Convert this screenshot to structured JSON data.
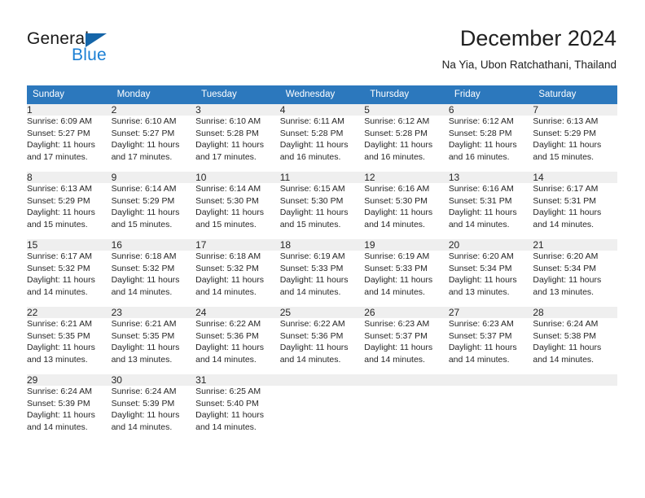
{
  "brand": {
    "word_one": "General",
    "word_two": "Blue",
    "triangle_color": "#1565a8",
    "blue_color": "#1b7fd4"
  },
  "header": {
    "title": "December 2024",
    "subtitle": "Na Yia, Ubon Ratchathani, Thailand"
  },
  "theme": {
    "header_blue": "#2c78bd",
    "row_rule_blue": "#1b6fb4",
    "daynum_band": "#efefef"
  },
  "weekdays": [
    "Sunday",
    "Monday",
    "Tuesday",
    "Wednesday",
    "Thursday",
    "Friday",
    "Saturday"
  ],
  "weeks": [
    [
      {
        "day": "1",
        "sunrise": "Sunrise: 6:09 AM",
        "sunset": "Sunset: 5:27 PM",
        "daylight_1": "Daylight: 11 hours",
        "daylight_2": "and 17 minutes."
      },
      {
        "day": "2",
        "sunrise": "Sunrise: 6:10 AM",
        "sunset": "Sunset: 5:27 PM",
        "daylight_1": "Daylight: 11 hours",
        "daylight_2": "and 17 minutes."
      },
      {
        "day": "3",
        "sunrise": "Sunrise: 6:10 AM",
        "sunset": "Sunset: 5:28 PM",
        "daylight_1": "Daylight: 11 hours",
        "daylight_2": "and 17 minutes."
      },
      {
        "day": "4",
        "sunrise": "Sunrise: 6:11 AM",
        "sunset": "Sunset: 5:28 PM",
        "daylight_1": "Daylight: 11 hours",
        "daylight_2": "and 16 minutes."
      },
      {
        "day": "5",
        "sunrise": "Sunrise: 6:12 AM",
        "sunset": "Sunset: 5:28 PM",
        "daylight_1": "Daylight: 11 hours",
        "daylight_2": "and 16 minutes."
      },
      {
        "day": "6",
        "sunrise": "Sunrise: 6:12 AM",
        "sunset": "Sunset: 5:28 PM",
        "daylight_1": "Daylight: 11 hours",
        "daylight_2": "and 16 minutes."
      },
      {
        "day": "7",
        "sunrise": "Sunrise: 6:13 AM",
        "sunset": "Sunset: 5:29 PM",
        "daylight_1": "Daylight: 11 hours",
        "daylight_2": "and 15 minutes."
      }
    ],
    [
      {
        "day": "8",
        "sunrise": "Sunrise: 6:13 AM",
        "sunset": "Sunset: 5:29 PM",
        "daylight_1": "Daylight: 11 hours",
        "daylight_2": "and 15 minutes."
      },
      {
        "day": "9",
        "sunrise": "Sunrise: 6:14 AM",
        "sunset": "Sunset: 5:29 PM",
        "daylight_1": "Daylight: 11 hours",
        "daylight_2": "and 15 minutes."
      },
      {
        "day": "10",
        "sunrise": "Sunrise: 6:14 AM",
        "sunset": "Sunset: 5:30 PM",
        "daylight_1": "Daylight: 11 hours",
        "daylight_2": "and 15 minutes."
      },
      {
        "day": "11",
        "sunrise": "Sunrise: 6:15 AM",
        "sunset": "Sunset: 5:30 PM",
        "daylight_1": "Daylight: 11 hours",
        "daylight_2": "and 15 minutes."
      },
      {
        "day": "12",
        "sunrise": "Sunrise: 6:16 AM",
        "sunset": "Sunset: 5:30 PM",
        "daylight_1": "Daylight: 11 hours",
        "daylight_2": "and 14 minutes."
      },
      {
        "day": "13",
        "sunrise": "Sunrise: 6:16 AM",
        "sunset": "Sunset: 5:31 PM",
        "daylight_1": "Daylight: 11 hours",
        "daylight_2": "and 14 minutes."
      },
      {
        "day": "14",
        "sunrise": "Sunrise: 6:17 AM",
        "sunset": "Sunset: 5:31 PM",
        "daylight_1": "Daylight: 11 hours",
        "daylight_2": "and 14 minutes."
      }
    ],
    [
      {
        "day": "15",
        "sunrise": "Sunrise: 6:17 AM",
        "sunset": "Sunset: 5:32 PM",
        "daylight_1": "Daylight: 11 hours",
        "daylight_2": "and 14 minutes."
      },
      {
        "day": "16",
        "sunrise": "Sunrise: 6:18 AM",
        "sunset": "Sunset: 5:32 PM",
        "daylight_1": "Daylight: 11 hours",
        "daylight_2": "and 14 minutes."
      },
      {
        "day": "17",
        "sunrise": "Sunrise: 6:18 AM",
        "sunset": "Sunset: 5:32 PM",
        "daylight_1": "Daylight: 11 hours",
        "daylight_2": "and 14 minutes."
      },
      {
        "day": "18",
        "sunrise": "Sunrise: 6:19 AM",
        "sunset": "Sunset: 5:33 PM",
        "daylight_1": "Daylight: 11 hours",
        "daylight_2": "and 14 minutes."
      },
      {
        "day": "19",
        "sunrise": "Sunrise: 6:19 AM",
        "sunset": "Sunset: 5:33 PM",
        "daylight_1": "Daylight: 11 hours",
        "daylight_2": "and 14 minutes."
      },
      {
        "day": "20",
        "sunrise": "Sunrise: 6:20 AM",
        "sunset": "Sunset: 5:34 PM",
        "daylight_1": "Daylight: 11 hours",
        "daylight_2": "and 13 minutes."
      },
      {
        "day": "21",
        "sunrise": "Sunrise: 6:20 AM",
        "sunset": "Sunset: 5:34 PM",
        "daylight_1": "Daylight: 11 hours",
        "daylight_2": "and 13 minutes."
      }
    ],
    [
      {
        "day": "22",
        "sunrise": "Sunrise: 6:21 AM",
        "sunset": "Sunset: 5:35 PM",
        "daylight_1": "Daylight: 11 hours",
        "daylight_2": "and 13 minutes."
      },
      {
        "day": "23",
        "sunrise": "Sunrise: 6:21 AM",
        "sunset": "Sunset: 5:35 PM",
        "daylight_1": "Daylight: 11 hours",
        "daylight_2": "and 13 minutes."
      },
      {
        "day": "24",
        "sunrise": "Sunrise: 6:22 AM",
        "sunset": "Sunset: 5:36 PM",
        "daylight_1": "Daylight: 11 hours",
        "daylight_2": "and 14 minutes."
      },
      {
        "day": "25",
        "sunrise": "Sunrise: 6:22 AM",
        "sunset": "Sunset: 5:36 PM",
        "daylight_1": "Daylight: 11 hours",
        "daylight_2": "and 14 minutes."
      },
      {
        "day": "26",
        "sunrise": "Sunrise: 6:23 AM",
        "sunset": "Sunset: 5:37 PM",
        "daylight_1": "Daylight: 11 hours",
        "daylight_2": "and 14 minutes."
      },
      {
        "day": "27",
        "sunrise": "Sunrise: 6:23 AM",
        "sunset": "Sunset: 5:37 PM",
        "daylight_1": "Daylight: 11 hours",
        "daylight_2": "and 14 minutes."
      },
      {
        "day": "28",
        "sunrise": "Sunrise: 6:24 AM",
        "sunset": "Sunset: 5:38 PM",
        "daylight_1": "Daylight: 11 hours",
        "daylight_2": "and 14 minutes."
      }
    ],
    [
      {
        "day": "29",
        "sunrise": "Sunrise: 6:24 AM",
        "sunset": "Sunset: 5:39 PM",
        "daylight_1": "Daylight: 11 hours",
        "daylight_2": "and 14 minutes."
      },
      {
        "day": "30",
        "sunrise": "Sunrise: 6:24 AM",
        "sunset": "Sunset: 5:39 PM",
        "daylight_1": "Daylight: 11 hours",
        "daylight_2": "and 14 minutes."
      },
      {
        "day": "31",
        "sunrise": "Sunrise: 6:25 AM",
        "sunset": "Sunset: 5:40 PM",
        "daylight_1": "Daylight: 11 hours",
        "daylight_2": "and 14 minutes."
      },
      {
        "day": "",
        "sunrise": "",
        "sunset": "",
        "daylight_1": "",
        "daylight_2": ""
      },
      {
        "day": "",
        "sunrise": "",
        "sunset": "",
        "daylight_1": "",
        "daylight_2": ""
      },
      {
        "day": "",
        "sunrise": "",
        "sunset": "",
        "daylight_1": "",
        "daylight_2": ""
      },
      {
        "day": "",
        "sunrise": "",
        "sunset": "",
        "daylight_1": "",
        "daylight_2": ""
      }
    ]
  ]
}
